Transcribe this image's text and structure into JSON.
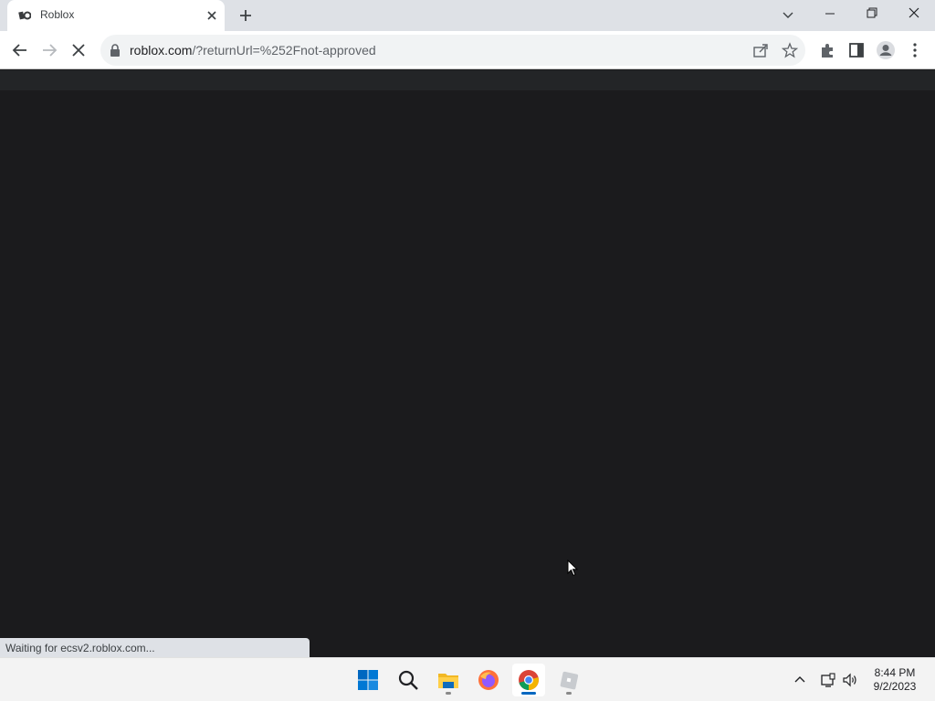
{
  "browser": {
    "tab": {
      "title": "Roblox"
    },
    "address": {
      "host": "roblox.com",
      "path": "/?returnUrl=%252Fnot-approved"
    }
  },
  "status_bar": {
    "text": "Waiting for ecsv2.roblox.com..."
  },
  "taskbar": {
    "apps": [
      "start-icon",
      "search-icon",
      "file-explorer-icon",
      "firefox-icon",
      "chrome-icon",
      "roblox-icon"
    ],
    "time": "8:44 PM",
    "date": "9/2/2023"
  },
  "colors": {
    "page_background": "#1b1b1d",
    "content_bar": "#232527",
    "chrome_frame": "#dee1e6",
    "taskbar": "#f3f3f3",
    "active_indicator": "#0067c0"
  }
}
